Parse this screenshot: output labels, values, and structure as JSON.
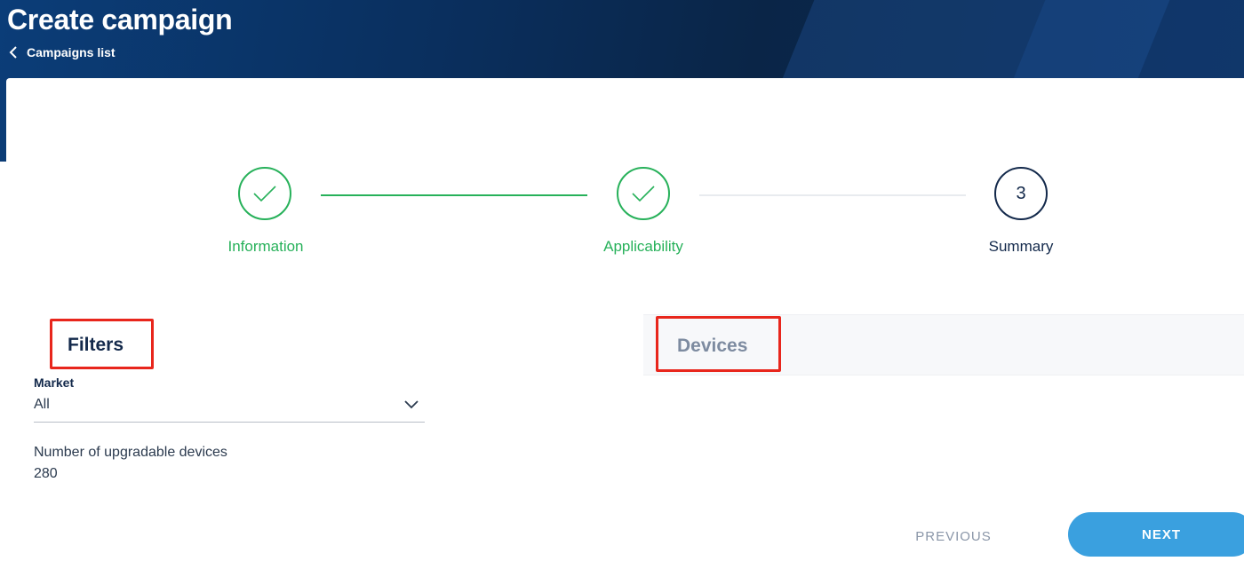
{
  "header": {
    "title": "Create campaign",
    "back_link": "Campaigns list"
  },
  "stepper": {
    "steps": [
      {
        "label": "Information",
        "status": "done"
      },
      {
        "label": "Applicability",
        "status": "done"
      },
      {
        "label": "Summary",
        "status": "current",
        "number": "3"
      }
    ]
  },
  "filters": {
    "title": "Filters",
    "market_label": "Market",
    "market_value": "All",
    "upgradable_label": "Number of upgradable devices",
    "upgradable_value": "280"
  },
  "devices": {
    "title": "Devices"
  },
  "actions": {
    "previous": "PREVIOUS",
    "next": "NEXT"
  },
  "colors": {
    "done": "#27b15a",
    "current": "#13294b",
    "primary_button": "#3aa0df",
    "highlight": "#e8261c"
  },
  "icons": {
    "back": "chevron-left-icon",
    "done_step": "check-icon",
    "select": "chevron-down-icon"
  }
}
